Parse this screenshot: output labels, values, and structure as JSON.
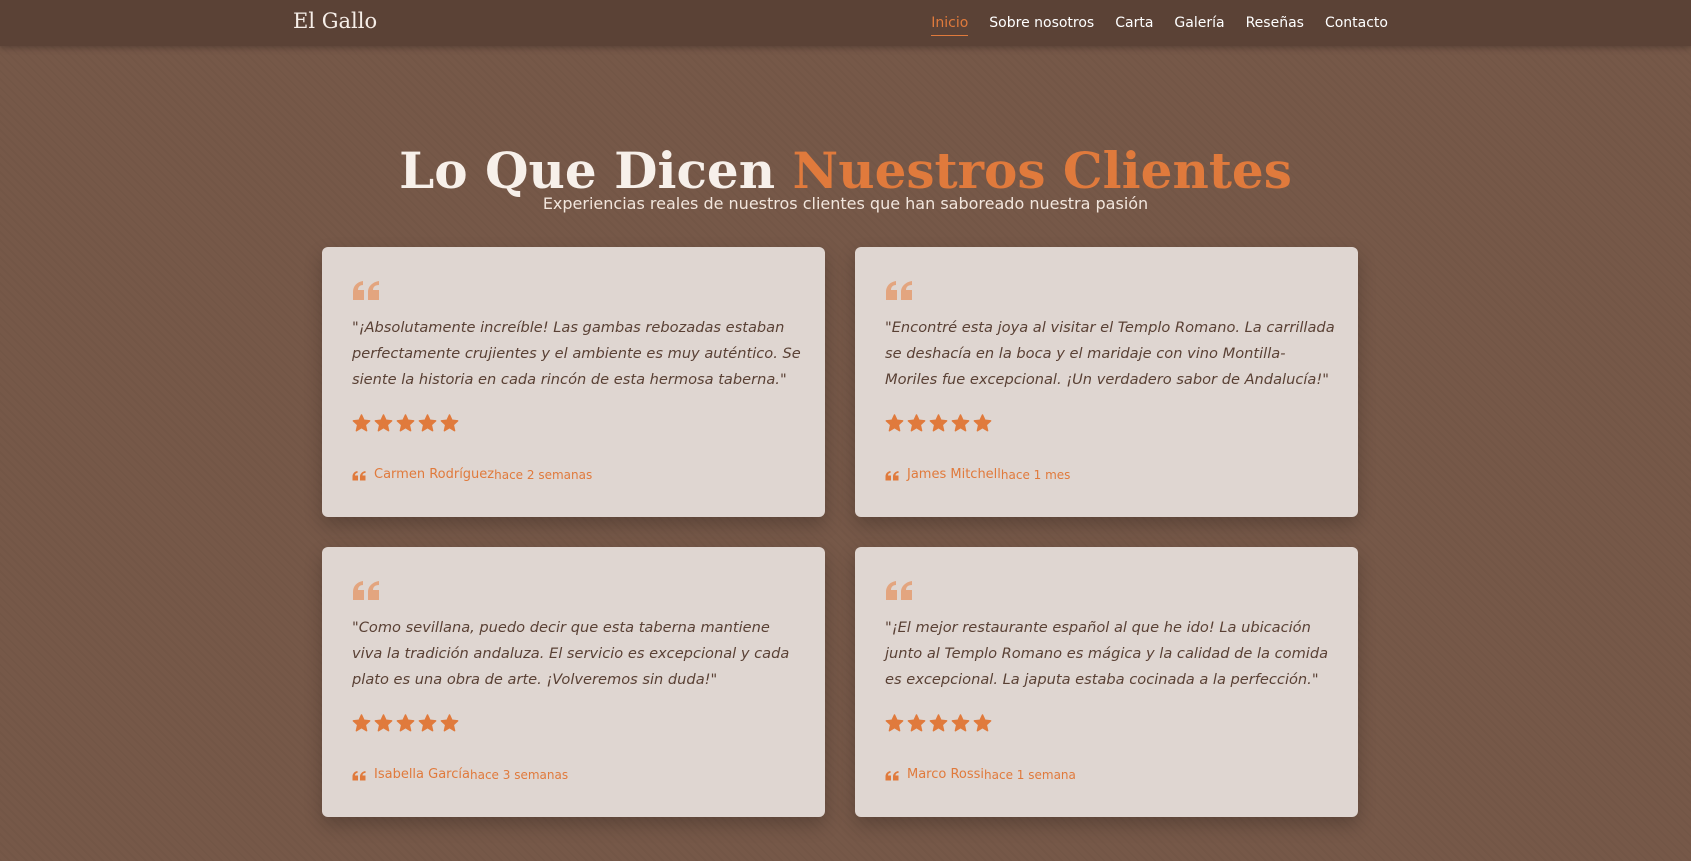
{
  "brand": "El Gallo",
  "nav": [
    {
      "label": "Inicio",
      "active": true
    },
    {
      "label": "Sobre nosotros",
      "active": false
    },
    {
      "label": "Carta",
      "active": false
    },
    {
      "label": "Galería",
      "active": false
    },
    {
      "label": "Reseñas",
      "active": false
    },
    {
      "label": "Contacto",
      "active": false
    }
  ],
  "hero": {
    "title_part1": "Lo Que Dicen ",
    "title_part2": "Nuestros Clientes",
    "subtitle": "Experiencias reales de nuestros clientes que han saboreado nuestra pasión"
  },
  "reviews": [
    {
      "text": "\"¡Absolutamente increíble! Las gambas rebozadas estaban perfectamente crujientes y el ambiente es muy auténtico. Se siente la historia en cada rincón de esta hermosa taberna.\"",
      "rating": 5,
      "author": "Carmen Rodríguez",
      "date": "hace 2 semanas"
    },
    {
      "text": "\"Encontré esta joya al visitar el Templo Romano. La carrillada se deshacía en la boca y el maridaje con vino Montilla-Moriles fue excepcional. ¡Un verdadero sabor de Andalucía!\"",
      "rating": 5,
      "author": "James Mitchell",
      "date": "hace 1 mes"
    },
    {
      "text": "\"Como sevillana, puedo decir que esta taberna mantiene viva la tradición andaluza. El servicio es excepcional y cada plato es una obra de arte. ¡Volveremos sin duda!\"",
      "rating": 5,
      "author": "Isabella García",
      "date": "hace 3 semanas"
    },
    {
      "text": "\"¡El mejor restaurante español al que he ido! La ubicación junto al Templo Romano es mágica y la calidad de la comida es excepcional. La japuta estaba cocinada a la perfección.\"",
      "rating": 5,
      "author": "Marco Rossi",
      "date": "hace 1 semana"
    }
  ],
  "colors": {
    "accent": "#e07a3c",
    "nav_bg": "#5b4236",
    "page_bg": "#765848",
    "card_bg": "#dfd6d1",
    "quote_icon": "#e3a57f"
  },
  "icons": {
    "quote": "quote-icon",
    "star": "star-icon"
  }
}
